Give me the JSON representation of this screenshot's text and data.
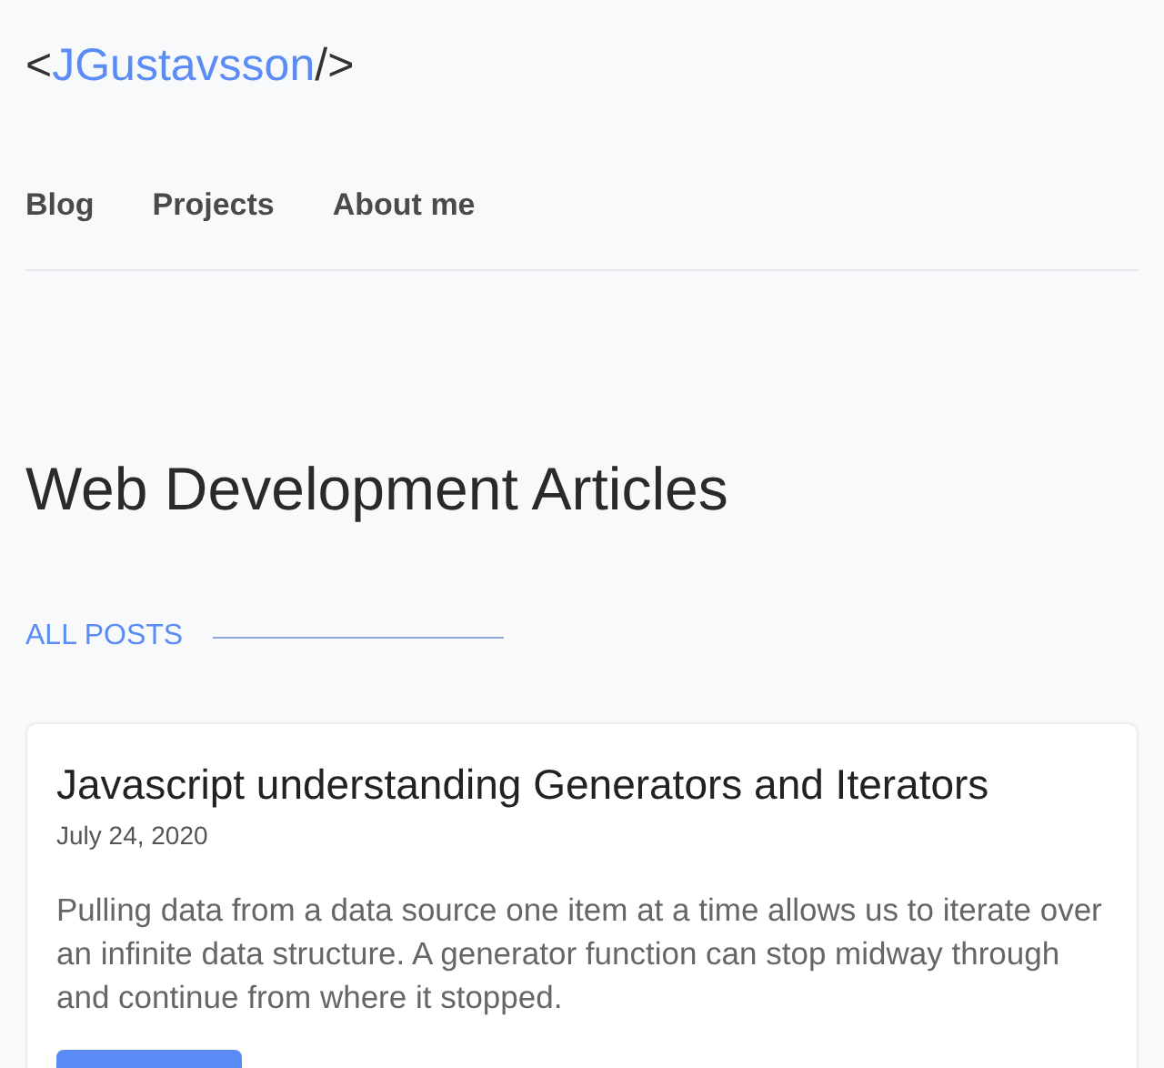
{
  "logo": {
    "open": "<",
    "name": "JGustavsson",
    "close": "/>"
  },
  "nav": [
    {
      "label": "Blog"
    },
    {
      "label": "Projects"
    },
    {
      "label": "About me"
    }
  ],
  "heading": "Web Development Articles",
  "section_label": "ALL POSTS",
  "articles": [
    {
      "title": "Javascript understanding Generators and Iterators",
      "date": "July 24, 2020",
      "excerpt": "Pulling data from a data source one item at a time allows us to iterate over an infinite data structure. A generator function can stop midway through and continue from where it stopped."
    }
  ]
}
